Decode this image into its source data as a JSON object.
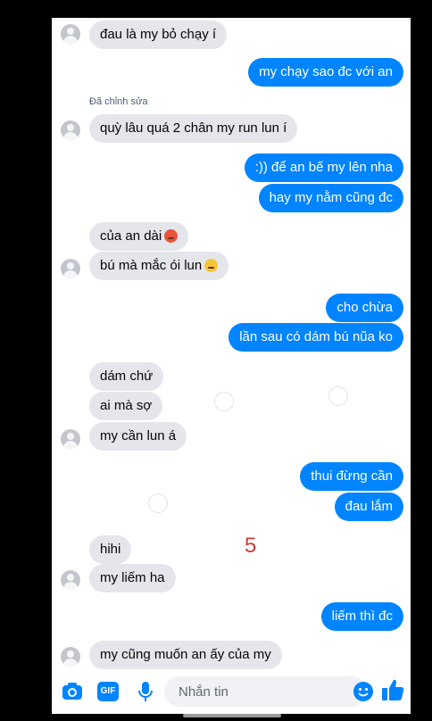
{
  "messages": [
    {
      "dir": "in",
      "text": "đau là my bỏ chạy í",
      "avatar": true
    },
    {
      "dir": "out",
      "text": "my chạy sao đc với an"
    },
    {
      "edited_label": "Đã chỉnh sửa",
      "dir": "in",
      "text": "quỳ lâu quá 2 chân my run lun í",
      "avatar": true
    },
    {
      "dir": "out",
      "text": ":)) để an bế my lên nha"
    },
    {
      "dir": "out",
      "text": "hay my nằm cũng đc"
    },
    {
      "dir": "in",
      "text": "của an dài",
      "emoji": "pouting-face-emoji"
    },
    {
      "dir": "in",
      "text": "bú mà mắc ói lun",
      "emoji": "pensive-face-emoji",
      "avatar": true
    },
    {
      "dir": "out",
      "text": "cho chừa"
    },
    {
      "dir": "out",
      "text": "lần sau có dám bú nũa ko"
    },
    {
      "dir": "in",
      "text": "dám chứ"
    },
    {
      "dir": "in",
      "text": "ai mà sợ"
    },
    {
      "dir": "in",
      "text": "my cần lun á",
      "avatar": true
    },
    {
      "dir": "out",
      "text": "thui đừng cần"
    },
    {
      "dir": "out",
      "text": "đau lắm"
    },
    {
      "dir": "in",
      "text": "hihi"
    },
    {
      "dir": "in",
      "text": "my liếm ha",
      "avatar": true
    },
    {
      "dir": "out",
      "text": "liếm thì đc"
    },
    {
      "dir": "in",
      "text": "my cũng muốn an ấy của my",
      "avatar": true
    }
  ],
  "page_number": "5",
  "composer": {
    "placeholder": "Nhắn tin",
    "gif_label": "GIF",
    "icons": [
      "camera-icon",
      "gif-icon",
      "microphone-icon",
      "emoji-icon",
      "thumbs-up-icon"
    ]
  },
  "colors": {
    "outgoing": "#0084ff",
    "incoming": "#e4e6eb",
    "accent": "#0084ff"
  }
}
